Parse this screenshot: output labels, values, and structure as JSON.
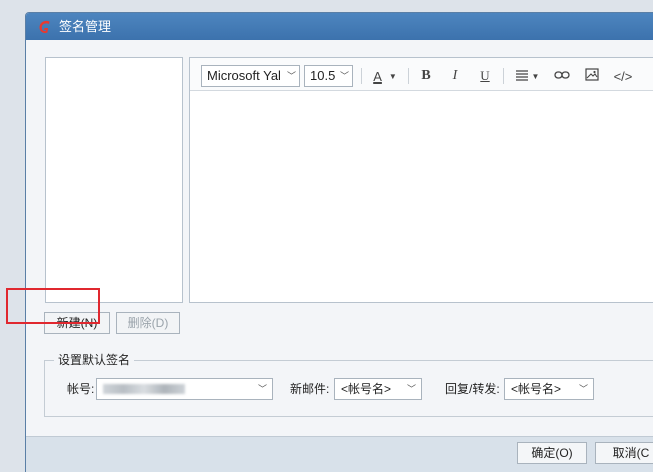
{
  "window": {
    "title": "签名管理",
    "accent": "#3f76b1"
  },
  "toolbar": {
    "font_name": "Microsoft Yal",
    "font_size": "10.5",
    "font_color_label": "A",
    "bold_label": "B",
    "italic_label": "I",
    "underline_label": "U",
    "source_label": "</>"
  },
  "actions": {
    "new_label": "新建(N)",
    "delete_label": "删除(D)"
  },
  "defaults": {
    "group_title": "设置默认签名",
    "account_label": "帐号:",
    "new_mail_label": "新邮件:",
    "new_mail_value": "<帐号名>",
    "reply_label": "回复/转发:",
    "reply_value": "<帐号名>"
  },
  "footer": {
    "ok_label": "确定(O)",
    "cancel_label": "取消(C"
  },
  "highlight_color": "#e0282f"
}
